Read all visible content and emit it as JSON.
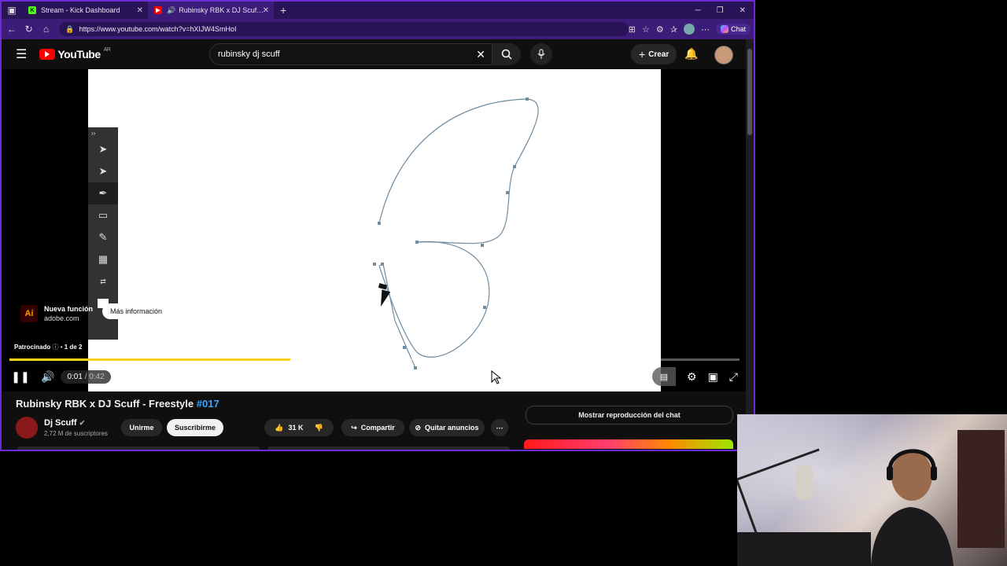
{
  "browser": {
    "tabs": [
      {
        "title": "Stream - Kick Dashboard",
        "favicon": "kick-icon",
        "active": false
      },
      {
        "title": "Rubinsky RBK x DJ Scuff - Fre",
        "favicon": "youtube-icon",
        "active": true
      }
    ],
    "url": "https://www.youtube.com/watch?v=hXIJW4SmHoI",
    "chat_label": "Chat"
  },
  "youtube": {
    "logo_text": "YouTube",
    "region": "AR",
    "search_value": "rubinsky dj scuff",
    "create_label": "Crear"
  },
  "ad": {
    "title": "Nueva función",
    "domain": "adobe.com",
    "cta": "Más información",
    "sponsored": "Patrocinado",
    "counter": "1 de 2",
    "icon_text": "Ai"
  },
  "player": {
    "current_time": "0:01",
    "duration": "/ 0:42",
    "progress_fraction": 0.385
  },
  "video": {
    "title": "Rubinsky RBK x DJ Scuff - Freestyle",
    "tag": "#017",
    "channel": "Dj Scuff",
    "subscribers": "2,72 M de suscriptores",
    "join_label": "Unirme",
    "subscribe_label": "Suscribirme",
    "likes": "31 K",
    "share_label": "Compartir",
    "remove_ads_label": "Quitar anuncios"
  },
  "sidebar": {
    "chat_replay_label": "Mostrar reproducción del chat"
  },
  "colors": {
    "browser_frame": "#6b2bd6",
    "progress": "#ffd21a",
    "youtube_red": "#ff0000",
    "tag_blue": "#3ea6ff"
  }
}
